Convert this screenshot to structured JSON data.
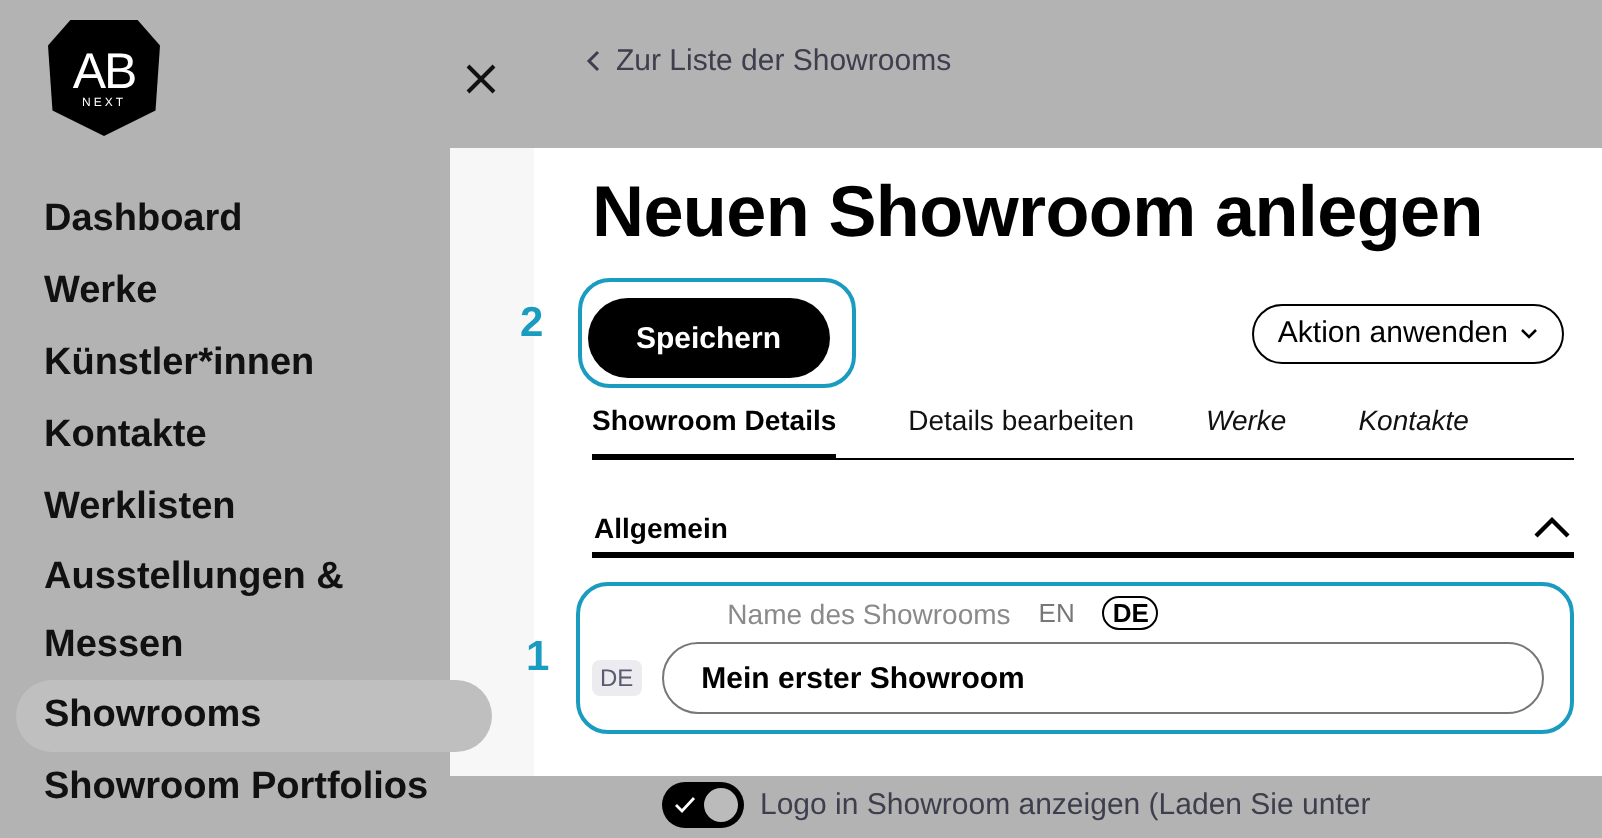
{
  "logo": {
    "text": "AB",
    "subtext": "NEXT"
  },
  "sidebar": {
    "items": [
      {
        "label": "Dashboard",
        "selected": false
      },
      {
        "label": "Werke",
        "selected": false
      },
      {
        "label": "Künstler*innen",
        "selected": false
      },
      {
        "label": "Kontakte",
        "selected": false
      },
      {
        "label": "Werklisten",
        "selected": false
      },
      {
        "label": "Ausstellungen & Messen",
        "selected": false
      },
      {
        "label": "Showrooms",
        "selected": true
      },
      {
        "label": "Showroom Portfolios",
        "selected": false
      }
    ]
  },
  "main": {
    "back_link": "Zur Liste der Showrooms",
    "title": "Neuen Showroom anlegen",
    "save_button": {
      "label": "Speichern",
      "step": "2"
    },
    "action_menu": {
      "label": "Aktion anwenden"
    },
    "tabs": [
      {
        "label": "Showroom Details",
        "selected": true,
        "kind": "normal"
      },
      {
        "label": "Details bearbeiten",
        "selected": false,
        "kind": "normal"
      },
      {
        "label": "Werke",
        "selected": false,
        "kind": "italic"
      },
      {
        "label": "Kontakte",
        "selected": false,
        "kind": "italic"
      }
    ],
    "section": {
      "title": "Allgemein",
      "expanded": true
    },
    "name_field": {
      "label": "Name des Showrooms",
      "languages": [
        {
          "code": "EN",
          "selected": false
        },
        {
          "code": "DE",
          "selected": true
        }
      ],
      "prefix": "DE",
      "value": "Mein erster Showroom",
      "step": "1"
    },
    "logo_toggle": {
      "on": true,
      "label": "Logo in Showroom anzeigen (Laden Sie unter"
    }
  }
}
